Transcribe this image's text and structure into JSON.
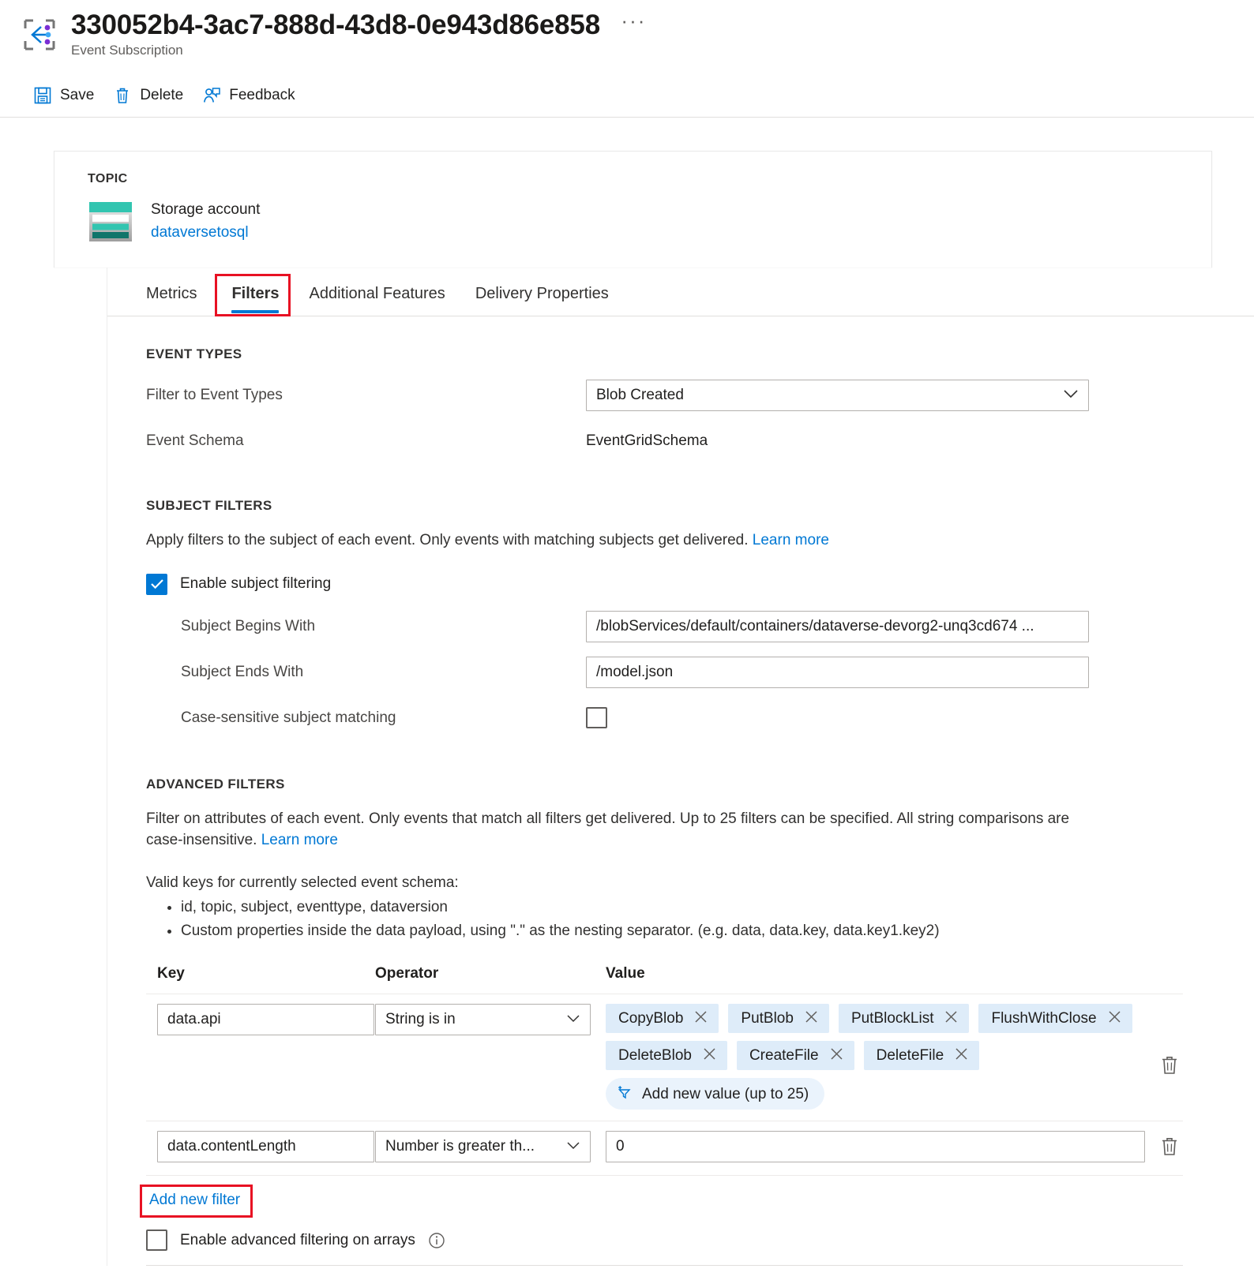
{
  "header": {
    "title": "330052b4-3ac7-888d-43d8-0e943d86e858",
    "subtitle": "Event Subscription",
    "ellipsis": "···",
    "icon": "event-subscription-icon"
  },
  "commandbar": {
    "items": [
      {
        "label": "Save",
        "icon": "save-icon"
      },
      {
        "label": "Delete",
        "icon": "trash-icon"
      },
      {
        "label": "Feedback",
        "icon": "feedback-person-icon"
      }
    ]
  },
  "topic": {
    "label": "TOPIC",
    "resource_type": "Storage account",
    "resource_name": "dataversetosql",
    "icon": "storage-account-icon"
  },
  "tabs": [
    {
      "label": "Metrics",
      "active": false
    },
    {
      "label": "Filters",
      "active": true,
      "highlighted": true
    },
    {
      "label": "Additional Features",
      "active": false
    },
    {
      "label": "Delivery Properties",
      "active": false
    }
  ],
  "event_types": {
    "section_title": "EVENT TYPES",
    "filter_label": "Filter to Event Types",
    "filter_value": "Blob Created",
    "schema_label": "Event Schema",
    "schema_value": "EventGridSchema"
  },
  "subject_filters": {
    "section_title": "SUBJECT FILTERS",
    "description": "Apply filters to the subject of each event. Only events with matching subjects get delivered.",
    "learn_more": "Learn more",
    "enable_label": "Enable subject filtering",
    "enable_checked": true,
    "begins_with_label": "Subject Begins With",
    "begins_with_value": "/blobServices/default/containers/dataverse-devorg2-unq3cd674 ...",
    "ends_with_label": "Subject Ends With",
    "ends_with_value": "/model.json",
    "case_sensitive_label": "Case-sensitive subject matching",
    "case_sensitive_checked": false
  },
  "advanced_filters": {
    "section_title": "ADVANCED FILTERS",
    "description": "Filter on attributes of each event. Only events that match all filters get delivered. Up to 25 filters can be specified. All string comparisons are case-insensitive.",
    "learn_more": "Learn more",
    "valid_keys_intro": "Valid keys for currently selected event schema:",
    "valid_keys": [
      "id, topic, subject, eventtype, dataversion",
      "Custom properties inside the data payload, using \".\" as the nesting separator. (e.g. data, data.key, data.key1.key2)"
    ],
    "columns": {
      "key": "Key",
      "operator": "Operator",
      "value": "Value"
    },
    "rows": [
      {
        "key": "data.api",
        "operator": "String is in",
        "value_type": "chips",
        "chips": [
          "CopyBlob",
          "PutBlob",
          "PutBlockList",
          "FlushWithClose",
          "DeleteBlob",
          "CreateFile",
          "DeleteFile"
        ],
        "add_value_label": "Add new value (up to 25)",
        "add_value_icon": "add-filter-icon",
        "delete_icon": "trash-icon"
      },
      {
        "key": "data.contentLength",
        "operator": "Number is greater th...",
        "value_type": "text",
        "value": "0",
        "delete_icon": "trash-icon"
      }
    ],
    "add_new_filter": "Add new filter",
    "add_new_filter_highlighted": true,
    "arrays_label": "Enable advanced filtering on arrays",
    "arrays_checked": false,
    "arrays_info_icon": "info-icon"
  },
  "colors": {
    "accent": "#0078d4",
    "highlight_box": "#e81123",
    "chip_bg": "#deecf9",
    "storage_teal": "#32c5b0"
  }
}
